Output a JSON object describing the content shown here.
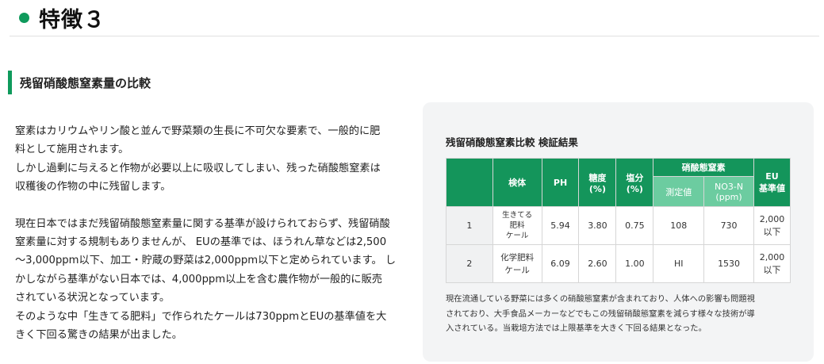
{
  "header": {
    "title": "特徴３"
  },
  "section": {
    "title": "残留硝酸態窒素量の比較"
  },
  "body": {
    "paragraph1": "窒素はカリウムやリン酸と並んで野菜類の生長に不可欠な要素で、一般的に肥\n料として施用されます。\nしかし過剰に与えると作物が必要以上に吸収してしまい、残った硝酸態窒素は\n収穫後の作物の中に残留します。",
    "paragraph2": "現在日本ではまだ残留硝酸態窒素量に関する基準が設けられておらず、残留硝酸\n窒素量に対する規制もありませんが、 EUの基準では、ほうれん草などは2,500\n〜3,000ppm以下、加工・貯蔵の野菜は2,000ppm以下と定められています。 し\nかしながら基準がない日本では、4,000ppm以上を含む農作物が一般的に販売\nされている状況となっています。\nそのような中「生きてる肥料」で作られたケールは730ppmとEUの基準値を大\nきく下回る驚きの結果が出ました。"
  },
  "panel": {
    "title": "残留硝酸態窒素比較 検証結果",
    "table": {
      "headers": {
        "blank": "",
        "sample": "検体",
        "ph": "PH",
        "brix": "糖度\n(%)",
        "salt": "塩分\n(%)",
        "nitrate_group": "硝酸態窒素",
        "measured": "測定値",
        "no3n": "NO3-N\n(ppm)",
        "eu": "EU\n基準値"
      },
      "rows": [
        {
          "idx": "1",
          "sample": "生きてる\n肥料\nケール",
          "ph": "5.94",
          "brix": "3.80",
          "salt": "0.75",
          "measured": "108",
          "no3n": "730",
          "eu": "2,000\n以下"
        },
        {
          "idx": "2",
          "sample": "化学肥料\nケール",
          "ph": "6.09",
          "brix": "2.60",
          "salt": "1.00",
          "measured": "HI",
          "no3n": "1530",
          "eu": "2,000\n以下"
        }
      ]
    },
    "note": "現在流通している野菜には多くの硝酸態窒素が含まれており、人体への影響も問題視\nされており、大手食品メーカーなどでもこの残留硝酸態窒素を減らす様々な技術が導\n入されている。当栽培方法では上限基準を大きく下回る結果となった。"
  },
  "colors": {
    "accent": "#0f9a5c",
    "accent_light": "#6ccca0",
    "panel_bg": "#f3f4f5"
  },
  "icons": {
    "header_bullet": "green-dot-icon"
  }
}
